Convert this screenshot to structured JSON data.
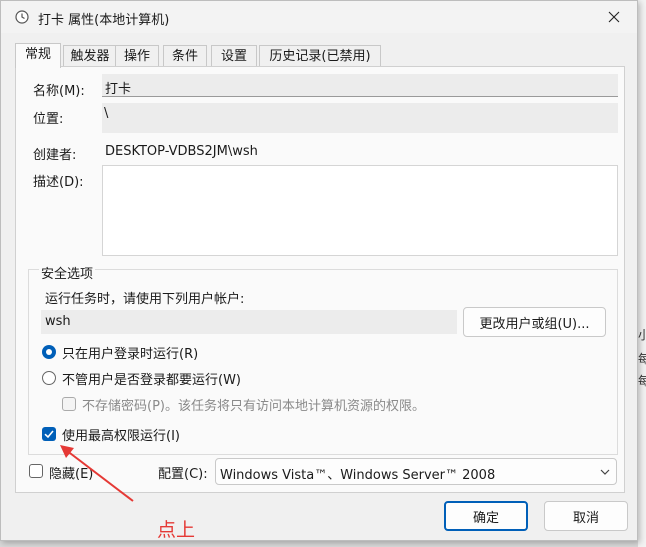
{
  "window": {
    "title": "打卡 属性(本地计算机)"
  },
  "tabs": [
    {
      "label": "常规"
    },
    {
      "label": "触发器"
    },
    {
      "label": "操作"
    },
    {
      "label": "条件"
    },
    {
      "label": "设置"
    },
    {
      "label": "历史记录(已禁用)"
    }
  ],
  "general": {
    "name_label": "名称(M):",
    "name_value": "打卡",
    "location_label": "位置:",
    "location_value": "\\",
    "author_label": "创建者:",
    "author_value": "DESKTOP-VDBS2JM\\wsh",
    "description_label": "描述(D):",
    "description_value": ""
  },
  "security": {
    "group_label": "安全选项",
    "run_as_prompt": "运行任务时，请使用下列用户帐户:",
    "user_account": "wsh",
    "change_user_button": "更改用户或组(U)...",
    "options": [
      {
        "label": "只在用户登录时运行(R)",
        "selected": true
      },
      {
        "label": "不管用户是否登录都要运行(W)",
        "selected": false
      }
    ],
    "no_store_password_label": "不存储密码(P)。该任务将只有访问本地计算机资源的权限。",
    "highest_privileges_label": "使用最高权限运行(I)",
    "highest_privileges_checked": true
  },
  "footer": {
    "hidden_label": "隐藏(E)",
    "configure_label": "配置(C):",
    "configure_value": "Windows Vista™、Windows Server™ 2008",
    "ok_button": "确定",
    "cancel_button": "取消"
  },
  "annotation": {
    "text": "点上",
    "color": "#e53935"
  },
  "background": {
    "left_fragment": "统",
    "right_fragments": [
      "小",
      "每",
      "每"
    ]
  },
  "colors": {
    "accent": "#005fb8"
  }
}
